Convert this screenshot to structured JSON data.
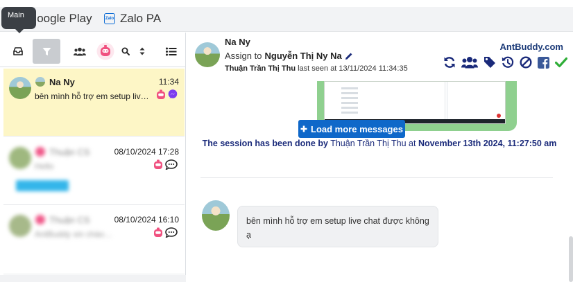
{
  "tooltip": {
    "text": "Main"
  },
  "channels": [
    {
      "label": "Google Play"
    },
    {
      "label": "Zalo PA",
      "logo_text": "Zalo"
    }
  ],
  "colors": {
    "accent": "#0f68c9",
    "active_conversation_bg": "#fdf6c6",
    "session_text": "#1a2a7a",
    "done_check": "#2fae38",
    "facebook": "#3b5998",
    "messenger": "#7b3cf0"
  },
  "conversations": [
    {
      "name": "Na Ny",
      "time": "11:34",
      "preview": "bên mình hỗ trợ em setup live chat được không ạ",
      "channels": [
        "bot-icon",
        "messenger-icon"
      ]
    },
    {
      "name": "Thuận CS",
      "time": "08/10/2024 17:28",
      "preview": "Hello",
      "channels": [
        "bot-icon",
        "chat-bubble-icon"
      ]
    },
    {
      "name": "Thuận CS",
      "time": "08/10/2024 16:10",
      "preview": "AntBuddy xin chào…",
      "channels": [
        "bot-icon",
        "chat-bubble-icon"
      ]
    }
  ],
  "header": {
    "name": "Na Ny",
    "assign_prefix": "Assign to",
    "assignee": "Nguyễn Thị Ny Na",
    "lastseen_agent": "Thuận Trần Thị Thu",
    "lastseen_text": "last seen at 13/11/2024 11:34:35",
    "brand": "AntBuddy.com"
  },
  "actions": [
    "refresh-icon",
    "users-icon",
    "tag-icon",
    "history-icon",
    "block-icon",
    "facebook-icon",
    "check-icon"
  ],
  "load_more": "Load more messages",
  "session": {
    "prefix": "The session has been done by",
    "agent": "Thuận Trần Thị Thu",
    "mid": "at",
    "datetime": "November 13th 2024, 11:27:50 am"
  },
  "message": {
    "text": "bên mình hỗ trợ em setup live chat được không ạ"
  }
}
